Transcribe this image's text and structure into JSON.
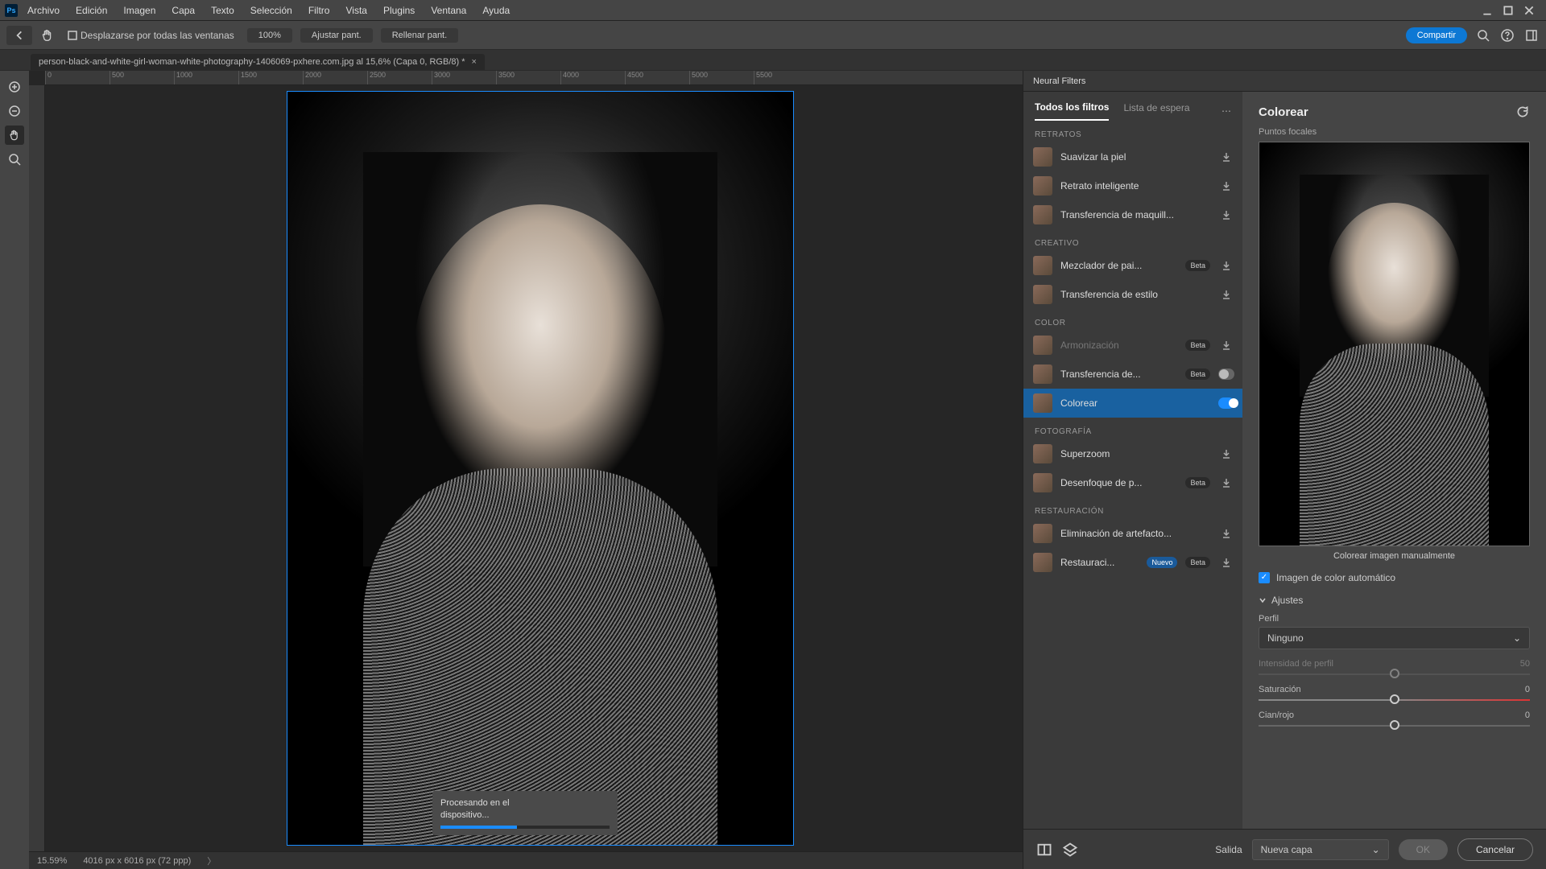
{
  "menu": [
    "Archivo",
    "Edición",
    "Imagen",
    "Capa",
    "Texto",
    "Selección",
    "Filtro",
    "Vista",
    "Plugins",
    "Ventana",
    "Ayuda"
  ],
  "options": {
    "scroll_all": "Desplazarse por todas las ventanas",
    "pct": "100%",
    "fit": "Ajustar pant.",
    "fill": "Rellenar pant.",
    "share": "Compartir"
  },
  "doc_tab": "person-black-and-white-girl-woman-white-photography-1406069-pxhere.com.jpg al 15,6% (Capa 0, RGB/8) *",
  "ruler_ticks": [
    "0",
    "500",
    "1000",
    "1500",
    "2000",
    "2500",
    "3000",
    "3500",
    "4000",
    "4500",
    "5000",
    "5500"
  ],
  "progress": {
    "line1": "Procesando en el",
    "line2": "dispositivo..."
  },
  "status": {
    "zoom": "15.59%",
    "dims": "4016 px x 6016 px (72 ppp)"
  },
  "nf": {
    "panel_title": "Neural Filters",
    "tabs": {
      "all": "Todos los filtros",
      "wait": "Lista de espera"
    },
    "sections": {
      "retratos": "RETRATOS",
      "creativo": "CREATIVO",
      "color": "COLOR",
      "fotografia": "FOTOGRAFÍA",
      "restauracion": "RESTAURACIÓN"
    },
    "filters": {
      "suavizar": "Suavizar la piel",
      "retrato": "Retrato inteligente",
      "maquillaje": "Transferencia de maquill...",
      "paisajes": "Mezclador de pai...",
      "estilo": "Transferencia de estilo",
      "armon": "Armonización",
      "transfcolor": "Transferencia de...",
      "colorear": "Colorear",
      "superzoom": "Superzoom",
      "desenfoque": "Desenfoque de p...",
      "artefactos": "Eliminación de artefacto...",
      "restauracion": "Restauraci..."
    },
    "badges": {
      "beta": "Beta",
      "nuevo": "Nuevo"
    }
  },
  "colorear": {
    "title": "Colorear",
    "points": "Puntos focales",
    "caption": "Colorear imagen manualmente",
    "auto": "Imagen de color automático",
    "ajustes": "Ajustes",
    "perfil": "Perfil",
    "perfil_val": "Ninguno",
    "intensidad": "Intensidad de perfil",
    "intensidad_val": "50",
    "saturacion": "Saturación",
    "saturacion_val": "0",
    "cian": "Cian/rojo",
    "cian_val": "0"
  },
  "footer": {
    "salida": "Salida",
    "salida_val": "Nueva capa",
    "ok": "OK",
    "cancel": "Cancelar"
  }
}
